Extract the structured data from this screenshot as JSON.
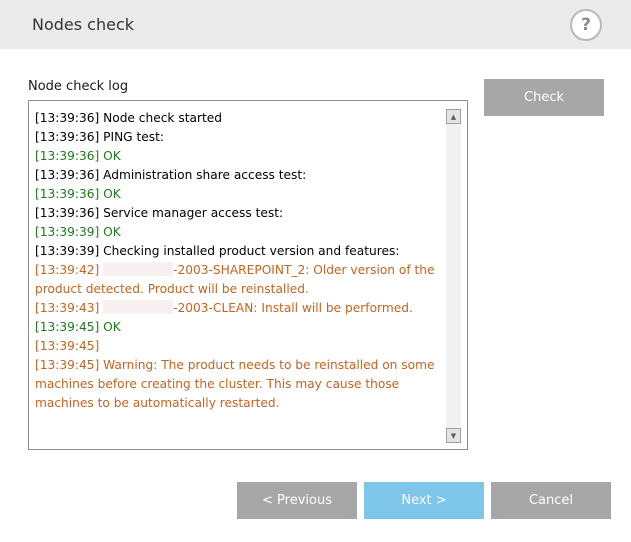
{
  "header": {
    "title": "Nodes check",
    "help_label": "?"
  },
  "log": {
    "label": "Node check log",
    "lines": [
      {
        "text": "[13:39:36] Node check started",
        "kind": "default"
      },
      {
        "text": "[13:39:36] PING test:",
        "kind": "default"
      },
      {
        "text": "[13:39:36] OK",
        "kind": "ok"
      },
      {
        "text": "[13:39:36] Administration share access test:",
        "kind": "default"
      },
      {
        "text": "[13:39:36] OK",
        "kind": "ok"
      },
      {
        "text": "[13:39:36] Service manager access test:",
        "kind": "default"
      },
      {
        "text": "[13:39:39] OK",
        "kind": "ok"
      },
      {
        "text": "[13:39:39] Checking installed product version and features:",
        "kind": "default"
      },
      {
        "text": "[13:39:42] ",
        "redacted": true,
        "suffix": "-2003-SHAREPOINT_2: Older version of the product detected. Product will be reinstalled.",
        "kind": "warn"
      },
      {
        "text": "[13:39:43] ",
        "redacted": true,
        "suffix": "-2003-CLEAN: Install will be performed.",
        "kind": "warn"
      },
      {
        "text": "[13:39:45] OK",
        "kind": "ok"
      },
      {
        "text": "[13:39:45]",
        "kind": "warn"
      },
      {
        "text": "[13:39:45] Warning: The product needs to be reinstalled on some machines before creating the cluster. This may cause those machines to be automatically restarted.",
        "kind": "warn"
      }
    ]
  },
  "buttons": {
    "check": "Check",
    "previous": "< Previous",
    "next": "Next >",
    "cancel": "Cancel"
  },
  "colors": {
    "ok": "#1d7a1d",
    "warn": "#c46420",
    "next_button": "#7dc6e9",
    "gray_button": "#a7a7a7"
  },
  "icons": {
    "scroll_up": "triangle-up",
    "scroll_down": "triangle-down"
  }
}
